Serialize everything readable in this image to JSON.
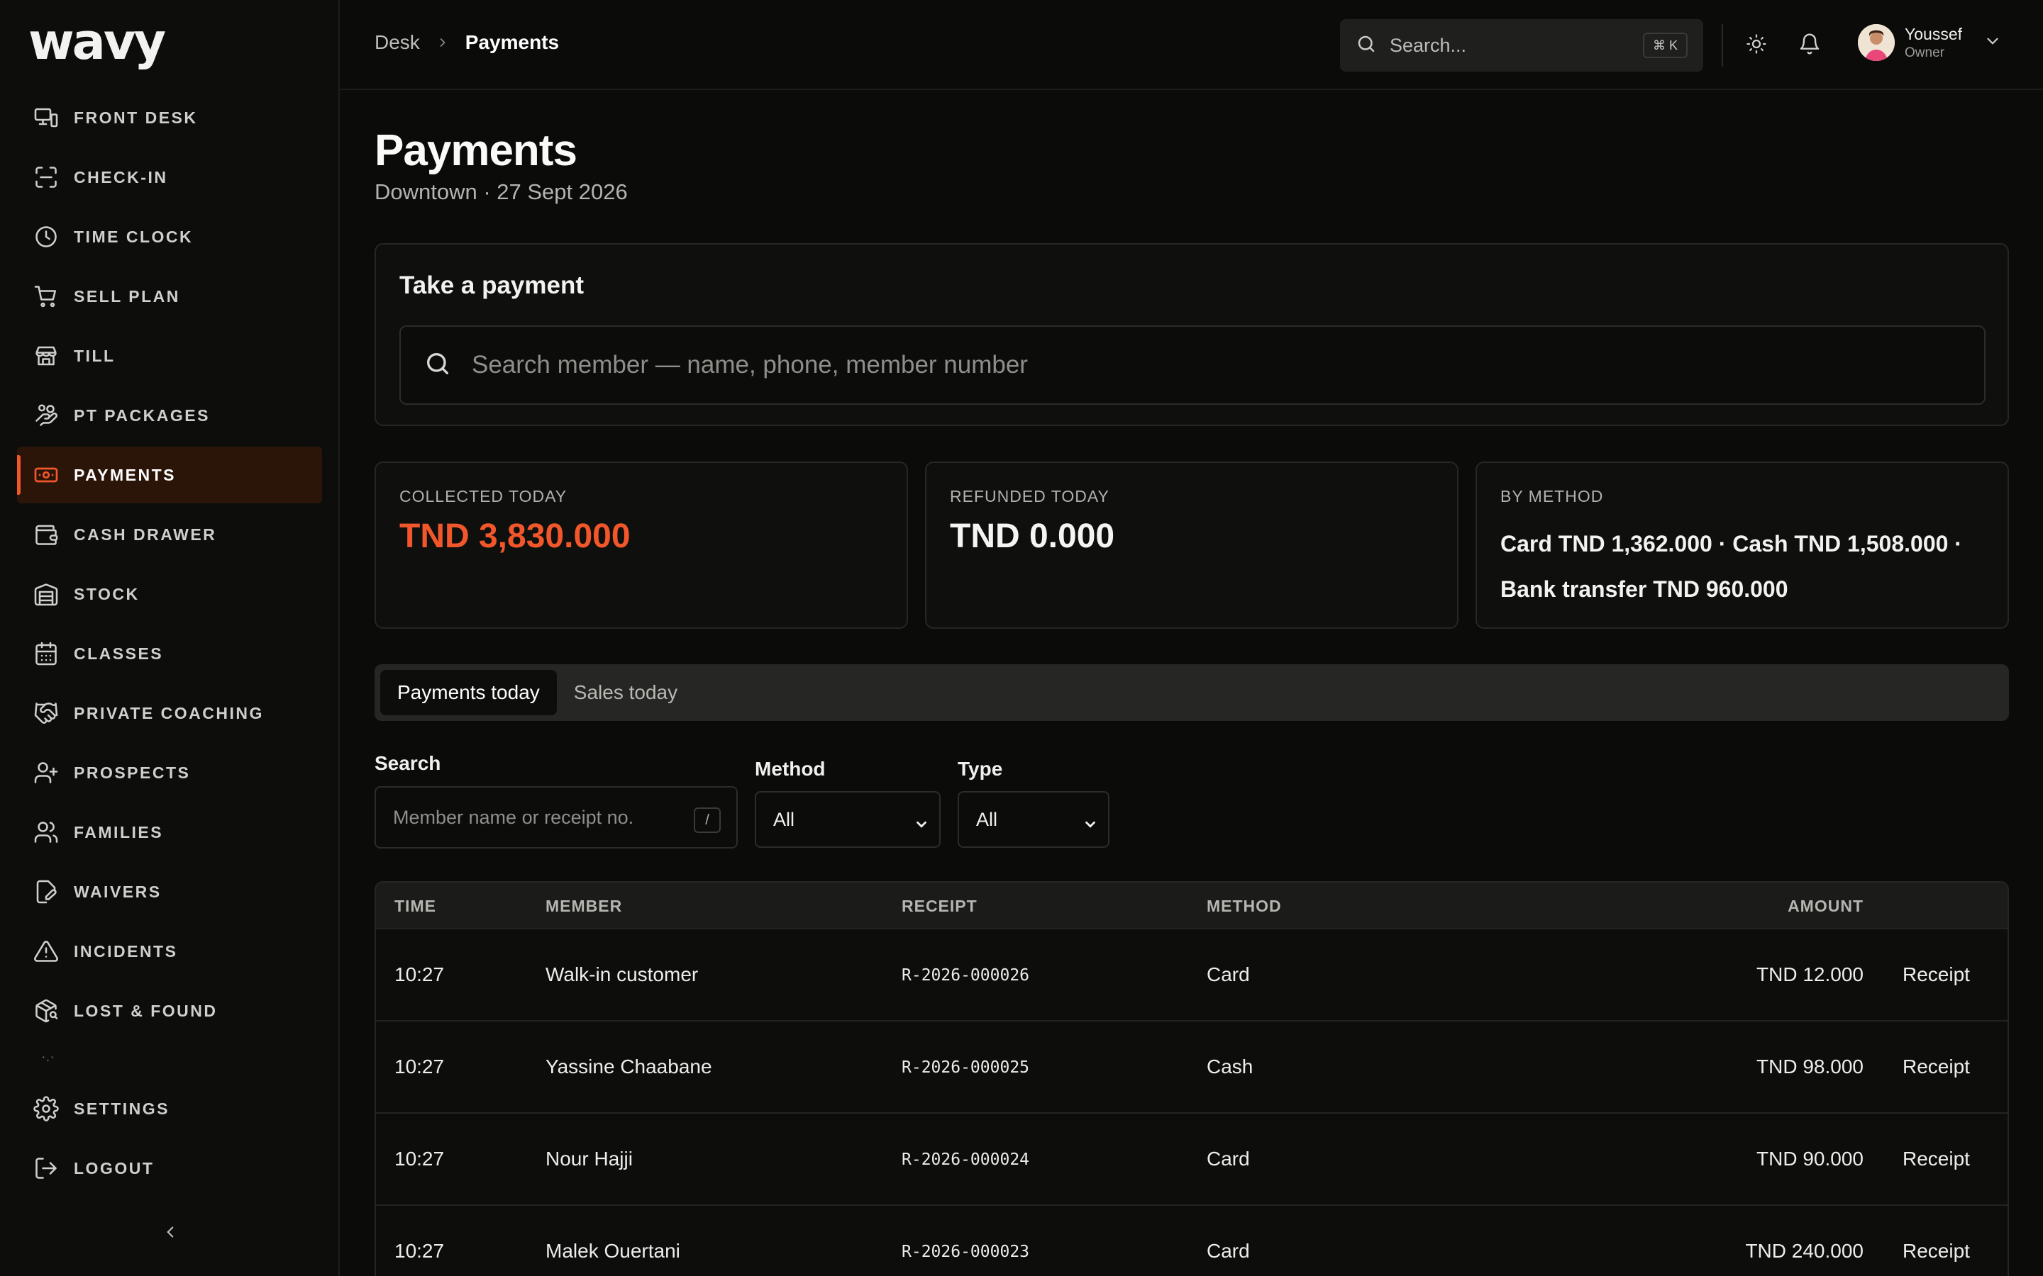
{
  "app": {
    "logo": "wavy"
  },
  "sidebar": {
    "items": [
      {
        "label": "FRONT DESK",
        "icon": "desk-monitor-icon"
      },
      {
        "label": "CHECK-IN",
        "icon": "scan-icon"
      },
      {
        "label": "TIME CLOCK",
        "icon": "clock-icon"
      },
      {
        "label": "SELL PLAN",
        "icon": "cart-icon"
      },
      {
        "label": "TILL",
        "icon": "store-icon"
      },
      {
        "label": "PT PACKAGES",
        "icon": "hand-coins-icon"
      },
      {
        "label": "PAYMENTS",
        "icon": "banknote-icon",
        "active": true
      },
      {
        "label": "CASH DRAWER",
        "icon": "wallet-icon"
      },
      {
        "label": "STOCK",
        "icon": "warehouse-icon"
      },
      {
        "label": "CLASSES",
        "icon": "calendar-icon"
      },
      {
        "label": "PRIVATE COACHING",
        "icon": "handshake-icon"
      },
      {
        "label": "PROSPECTS",
        "icon": "user-plus-icon"
      },
      {
        "label": "FAMILIES",
        "icon": "users-icon"
      },
      {
        "label": "WAIVERS",
        "icon": "file-pen-icon"
      },
      {
        "label": "INCIDENTS",
        "icon": "alert-triangle-icon"
      },
      {
        "label": "LOST & FOUND",
        "icon": "package-search-icon"
      }
    ],
    "bottom": [
      {
        "label": "SETTINGS",
        "icon": "gear-icon"
      },
      {
        "label": "LOGOUT",
        "icon": "logout-icon"
      }
    ]
  },
  "topbar": {
    "breadcrumb": [
      "Desk",
      "Payments"
    ],
    "search_placeholder": "Search...",
    "search_shortcut": "⌘ K",
    "user": {
      "name": "Youssef",
      "role": "Owner"
    }
  },
  "page": {
    "title": "Payments",
    "subtitle": "Downtown · 27 Sept 2026"
  },
  "take_payment": {
    "title": "Take a payment",
    "placeholder": "Search member — name, phone, member number"
  },
  "stats": {
    "collected": {
      "label": "COLLECTED TODAY",
      "value": "TND 3,830.000",
      "color": "#f2572b"
    },
    "refunded": {
      "label": "REFUNDED TODAY",
      "value": "TND 0.000"
    },
    "by_method": {
      "label": "BY METHOD",
      "value": "Card TND 1,362.000 · Cash TND 1,508.000 · Bank transfer TND 960.000"
    }
  },
  "tabs": [
    {
      "label": "Payments today",
      "active": true
    },
    {
      "label": "Sales today"
    }
  ],
  "filters": {
    "search_label": "Search",
    "search_placeholder": "Member name or receipt no.",
    "search_shortcut": "/",
    "method_label": "Method",
    "method_value": "All",
    "type_label": "Type",
    "type_value": "All"
  },
  "table": {
    "columns": [
      "TIME",
      "MEMBER",
      "RECEIPT",
      "METHOD",
      "AMOUNT"
    ],
    "rows": [
      {
        "time": "10:27",
        "member": "Walk-in customer",
        "receipt": "R-2026-000026",
        "method": "Card",
        "amount": "TND 12.000",
        "action": "Receipt"
      },
      {
        "time": "10:27",
        "member": "Yassine Chaabane",
        "receipt": "R-2026-000025",
        "method": "Cash",
        "amount": "TND 98.000",
        "action": "Receipt"
      },
      {
        "time": "10:27",
        "member": "Nour Hajji",
        "receipt": "R-2026-000024",
        "method": "Card",
        "amount": "TND 90.000",
        "action": "Receipt"
      },
      {
        "time": "10:27",
        "member": "Malek Ouertani",
        "receipt": "R-2026-000023",
        "method": "Card",
        "amount": "TND 240.000",
        "action": "Receipt"
      }
    ]
  }
}
